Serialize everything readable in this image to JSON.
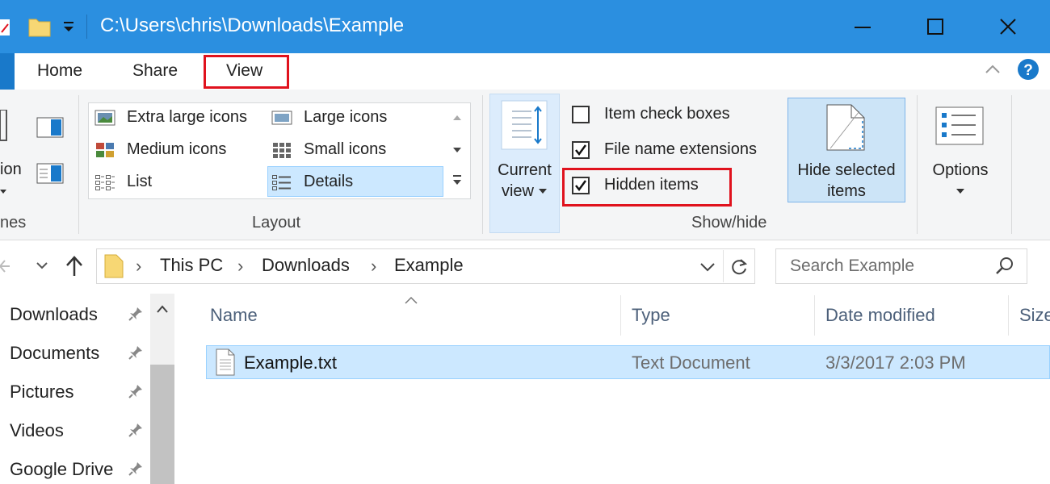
{
  "window": {
    "title": "C:\\Users\\chris\\Downloads\\Example",
    "colors": {
      "titlebar": "#2b8fe0",
      "selection": "#cce8ff",
      "highlight": "#e0121d"
    }
  },
  "tabs": [
    {
      "label": "Home"
    },
    {
      "label": "Share"
    },
    {
      "label": "View",
      "active": true
    }
  ],
  "ribbon": {
    "panes_partial": {
      "label_fragment": "ion",
      "group_label_fragment": "nes"
    },
    "layout": {
      "group_label": "Layout",
      "items": [
        {
          "label": "Extra large icons"
        },
        {
          "label": "Large icons"
        },
        {
          "label": "Medium icons"
        },
        {
          "label": "Small icons"
        },
        {
          "label": "List"
        },
        {
          "label": "Details",
          "selected": true
        }
      ]
    },
    "current_view": {
      "line1": "Current",
      "line2": "view"
    },
    "show_hide": {
      "group_label": "Show/hide",
      "checkboxes": [
        {
          "label": "Item check boxes",
          "checked": false
        },
        {
          "label": "File name extensions",
          "checked": true
        },
        {
          "label": "Hidden items",
          "checked": true
        }
      ],
      "hide_selected": {
        "line1": "Hide selected",
        "line2": "items"
      }
    },
    "options": {
      "label": "Options"
    }
  },
  "address": {
    "crumbs": [
      "This PC",
      "Downloads",
      "Example"
    ],
    "search_placeholder": "Search Example"
  },
  "nav": {
    "items": [
      {
        "label": "Downloads"
      },
      {
        "label": "Documents"
      },
      {
        "label": "Pictures"
      },
      {
        "label": "Videos"
      },
      {
        "label": "Google Drive"
      }
    ]
  },
  "files": {
    "columns": [
      "Name",
      "Type",
      "Date modified",
      "Size"
    ],
    "rows": [
      {
        "name": "Example.txt",
        "type": "Text Document",
        "date": "3/3/2017 2:03 PM"
      }
    ]
  }
}
